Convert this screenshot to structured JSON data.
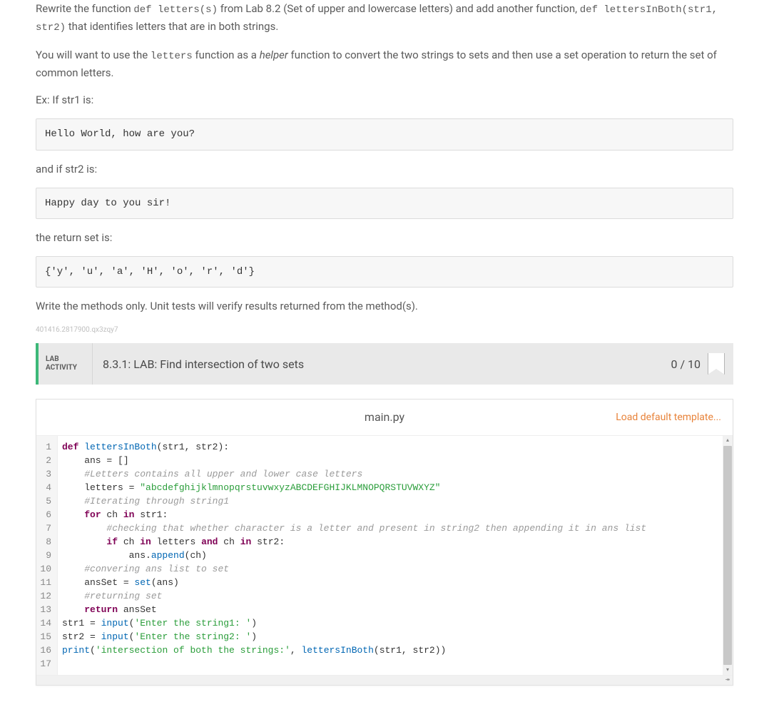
{
  "instructions": {
    "p1_pre": "Rewrite the function ",
    "p1_code1": "def letters(s)",
    "p1_mid": " from Lab 8.2 (Set of upper and lowercase letters) and add another function, ",
    "p1_code2": "def lettersInBoth(str1, str2)",
    "p1_post": " that identifies letters that are in both strings.",
    "p2_pre": "You will want to use the ",
    "p2_code": "letters",
    "p2_mid": " function as a ",
    "p2_em": "helper",
    "p2_post": " function to convert the two strings to sets and then use a set operation to return the set of common letters.",
    "ex1": "Ex: If str1 is:",
    "box1": "Hello World, how are you?",
    "ex2": "and if str2 is:",
    "box2": "Happy day to you sir!",
    "ex3": "the return set is:",
    "box3": "{'y', 'u', 'a', 'H', 'o', 'r', 'd'}",
    "p3": "Write the methods only. Unit tests will verify results returned from the method(s)."
  },
  "watermark": "401416.2817900.qx3zqy7",
  "activity": {
    "label_line1": "LAB",
    "label_line2": "ACTIVITY",
    "title": "8.3.1: LAB: Find intersection of two sets",
    "score": "0 / 10"
  },
  "editor": {
    "filename": "main.py",
    "load_template": "Load default template...",
    "lines": [
      {
        "n": "1",
        "tokens": [
          [
            "kw",
            "def"
          ],
          [
            "",
            " "
          ],
          [
            "fn",
            "lettersInBoth"
          ],
          [
            "",
            "(str1, str2):"
          ]
        ]
      },
      {
        "n": "2",
        "tokens": [
          [
            "",
            "    ans = []"
          ]
        ]
      },
      {
        "n": "3",
        "tokens": [
          [
            "",
            "    "
          ],
          [
            "cmt",
            "#Letters contains all upper and lower case letters"
          ]
        ]
      },
      {
        "n": "4",
        "tokens": [
          [
            "",
            "    letters = "
          ],
          [
            "str",
            "\"abcdefghijklmnopqrstuvwxyzABCDEFGHIJKLMNOPQRSTUVWXYZ\""
          ]
        ]
      },
      {
        "n": "5",
        "tokens": [
          [
            "",
            "    "
          ],
          [
            "cmt",
            "#Iterating through string1"
          ]
        ]
      },
      {
        "n": "6",
        "tokens": [
          [
            "",
            "    "
          ],
          [
            "kw",
            "for"
          ],
          [
            "",
            " ch "
          ],
          [
            "kw",
            "in"
          ],
          [
            "",
            " str1:"
          ]
        ]
      },
      {
        "n": "7",
        "tokens": [
          [
            "",
            "        "
          ],
          [
            "cmt",
            "#checking that whether character is a letter and present in string2 then appending it in ans list"
          ]
        ]
      },
      {
        "n": "8",
        "tokens": [
          [
            "",
            "        "
          ],
          [
            "kw",
            "if"
          ],
          [
            "",
            " ch "
          ],
          [
            "kw",
            "in"
          ],
          [
            "",
            " letters "
          ],
          [
            "kw",
            "and"
          ],
          [
            "",
            " ch "
          ],
          [
            "kw",
            "in"
          ],
          [
            "",
            " str2:"
          ]
        ]
      },
      {
        "n": "9",
        "tokens": [
          [
            "",
            "            ans."
          ],
          [
            "fn",
            "append"
          ],
          [
            "",
            "(ch)"
          ]
        ]
      },
      {
        "n": "10",
        "tokens": [
          [
            "",
            "    "
          ],
          [
            "cmt",
            "#convering ans list to set"
          ]
        ]
      },
      {
        "n": "11",
        "tokens": [
          [
            "",
            "    ansSet = "
          ],
          [
            "fn",
            "set"
          ],
          [
            "",
            "(ans)"
          ]
        ]
      },
      {
        "n": "12",
        "tokens": [
          [
            "",
            "    "
          ],
          [
            "cmt",
            "#returning set"
          ]
        ]
      },
      {
        "n": "13",
        "tokens": [
          [
            "",
            "    "
          ],
          [
            "kw",
            "return"
          ],
          [
            "",
            " ansSet"
          ]
        ]
      },
      {
        "n": "14",
        "tokens": [
          [
            "",
            ""
          ]
        ]
      },
      {
        "n": "15",
        "tokens": [
          [
            "",
            "str1 = "
          ],
          [
            "fn",
            "input"
          ],
          [
            "",
            "("
          ],
          [
            "str",
            "'Enter the string1: '"
          ],
          [
            "",
            ")"
          ]
        ]
      },
      {
        "n": "16",
        "tokens": [
          [
            "",
            "str2 = "
          ],
          [
            "fn",
            "input"
          ],
          [
            "",
            "("
          ],
          [
            "str",
            "'Enter the string2: '"
          ],
          [
            "",
            ")"
          ]
        ]
      },
      {
        "n": "17",
        "tokens": [
          [
            "fn",
            "print"
          ],
          [
            "",
            "("
          ],
          [
            "str",
            "'intersection of both the strings:'"
          ],
          [
            "",
            ", "
          ],
          [
            "fn",
            "lettersInBoth"
          ],
          [
            "",
            "(str1, str2))"
          ]
        ]
      }
    ]
  }
}
